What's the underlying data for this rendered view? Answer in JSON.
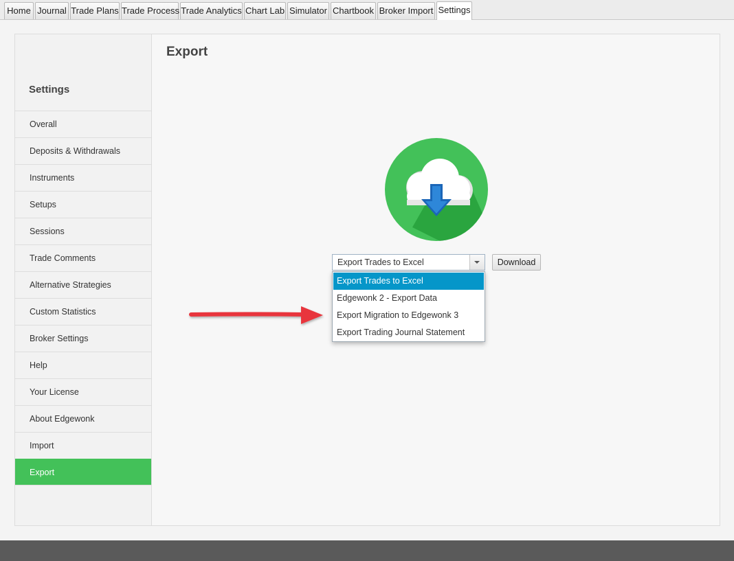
{
  "tabs": [
    {
      "label": "Home",
      "active": false
    },
    {
      "label": "Journal",
      "active": false
    },
    {
      "label": "Trade Plans",
      "active": false
    },
    {
      "label": "Trade Process",
      "active": false
    },
    {
      "label": "Trade Analytics",
      "active": false
    },
    {
      "label": "Chart Lab",
      "active": false
    },
    {
      "label": "Simulator",
      "active": false
    },
    {
      "label": "Chartbook",
      "active": false
    },
    {
      "label": "Broker Import",
      "active": false
    },
    {
      "label": "Settings",
      "active": true
    }
  ],
  "sidebar": {
    "title": "Settings",
    "items": [
      {
        "label": "Overall"
      },
      {
        "label": "Deposits & Withdrawals"
      },
      {
        "label": "Instruments"
      },
      {
        "label": "Setups"
      },
      {
        "label": "Sessions"
      },
      {
        "label": "Trade Comments"
      },
      {
        "label": "Alternative Strategies"
      },
      {
        "label": "Custom Statistics"
      },
      {
        "label": "Broker Settings"
      },
      {
        "label": "Help"
      },
      {
        "label": "Your License"
      },
      {
        "label": "About Edgewonk"
      },
      {
        "label": "Import"
      },
      {
        "label": "Export",
        "active": true
      }
    ]
  },
  "main": {
    "title": "Export",
    "icon": "cloud-download-icon",
    "export_select": {
      "value": "Export Trades to Excel",
      "options": [
        "Export Trades to Excel",
        "Edgewonk 2 - Export Data",
        "Export Migration to Edgewonk 3",
        "Export Trading Journal Statement"
      ],
      "selected_index": 0
    },
    "download_label": "Download"
  },
  "colors": {
    "accent_green": "#43c159",
    "selection_blue": "#0596c9",
    "annotation_arrow": "#e8363c",
    "footer": "#5a5a5a"
  }
}
